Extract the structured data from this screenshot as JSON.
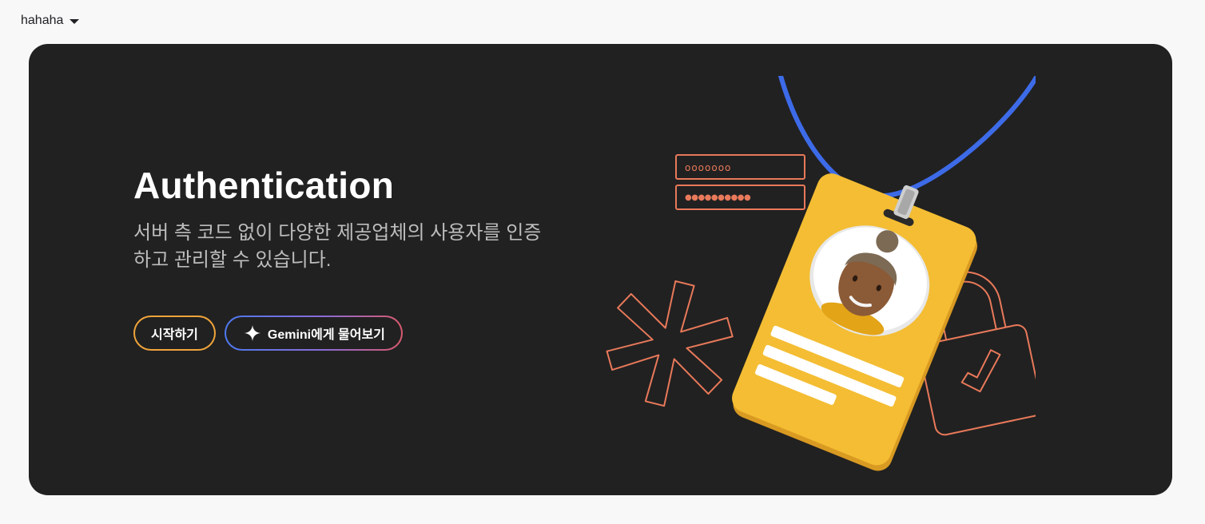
{
  "project": {
    "name": "hahaha",
    "menu_icon": "caret-down-icon"
  },
  "hero": {
    "title": "Authentication",
    "description": "서버 측 코드 없이 다양한 제공업체의 사용자를 인증하고 관리할 수 있습니다.",
    "buttons": {
      "start_label": "시작하기",
      "gemini_label": "Gemini에게 물어보기",
      "gemini_icon": "sparkle-icon"
    }
  },
  "illustration": {
    "password_field_1": "ooooooo",
    "password_field_2": "●●●●●●●●●●",
    "icons": [
      "lanyard-icon",
      "id-badge-icon",
      "avatar-icon",
      "asterisk-icon",
      "padlock-icon",
      "checkmark-icon"
    ]
  },
  "colors": {
    "page_bg": "#f8f8f8",
    "hero_bg": "#212121",
    "accent_orange": "#f0a43a",
    "outline_orange": "#e8795a",
    "lanyard_blue": "#3d6be8",
    "badge_yellow": "#f4bd33"
  }
}
